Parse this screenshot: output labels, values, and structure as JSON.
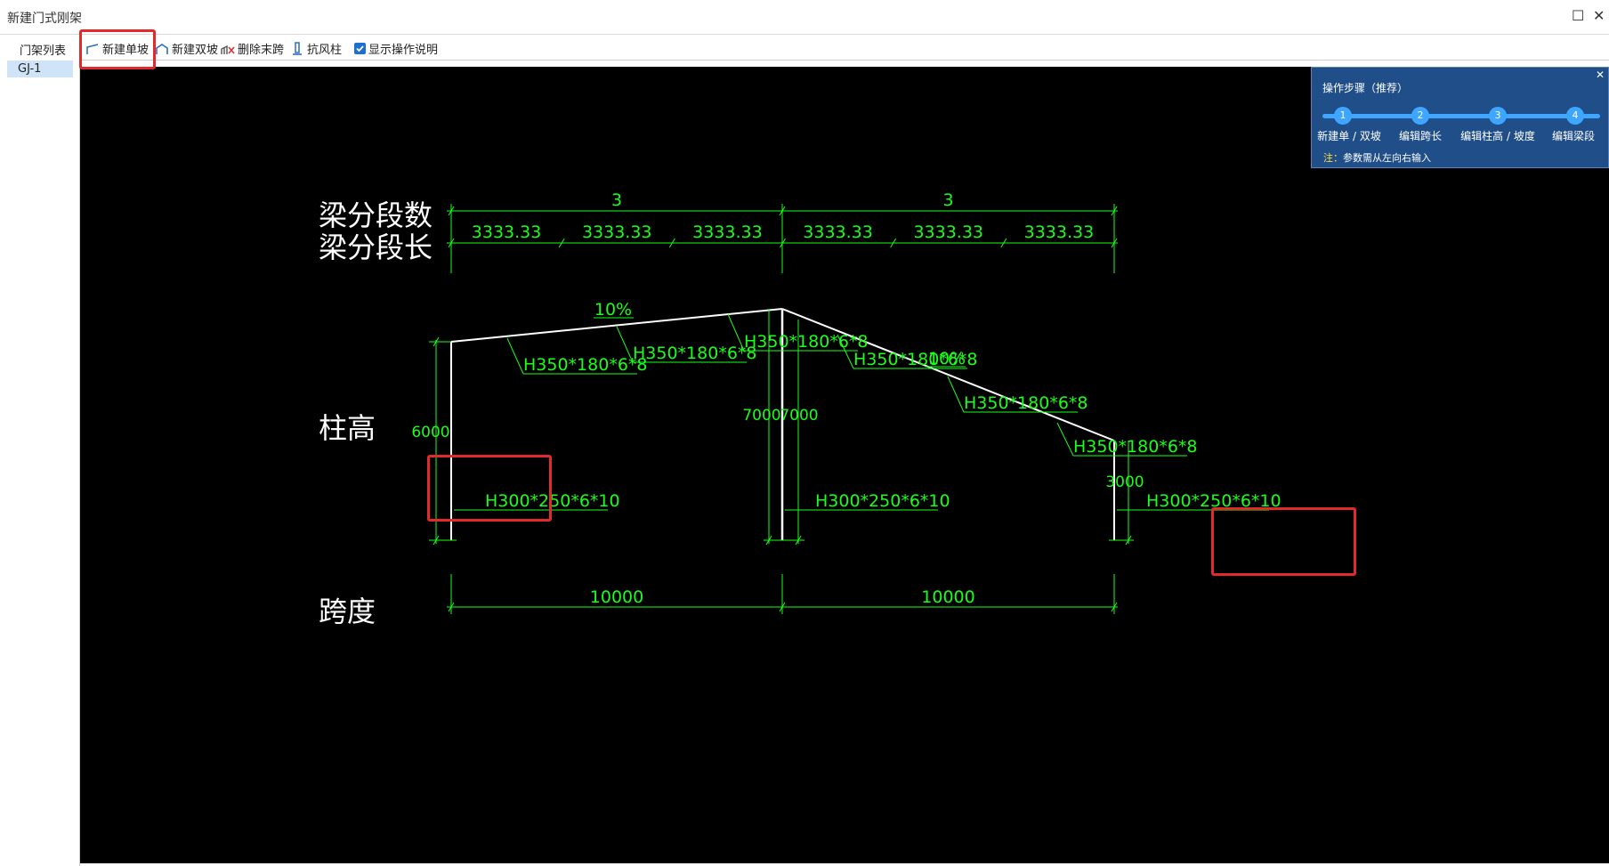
{
  "window": {
    "title": "新建门式刚架"
  },
  "toolbar": {
    "new_single_slope": "新建单坡",
    "new_double_slope": "新建双坡",
    "delete_end_span": "删除末跨",
    "wind_column": "抗风柱",
    "show_instructions": "显示操作说明"
  },
  "left_panel": {
    "title": "门架列表",
    "items": [
      "GJ-1"
    ]
  },
  "overlay": {
    "title": "操作步骤（推荐）",
    "steps": [
      {
        "num": "1",
        "label": "新建单 / 双坡"
      },
      {
        "num": "2",
        "label": "编辑跨长"
      },
      {
        "num": "3",
        "label": "编辑柱高 / 坡度"
      },
      {
        "num": "4",
        "label": "编辑梁段"
      }
    ],
    "note_prefix": "注：",
    "note_text": "参数需从左向右输入"
  },
  "drawing": {
    "row_labels": {
      "beam_segment_count": "梁分段数",
      "beam_segment_length": "梁分段长",
      "column_height": "柱高",
      "span": "跨度"
    },
    "segment_counts": [
      "3",
      "3"
    ],
    "segment_lengths": [
      "3333.33",
      "3333.33",
      "3333.33",
      "3333.33",
      "3333.33",
      "3333.33"
    ],
    "slopes": [
      "10%",
      "10%"
    ],
    "beam_sections": [
      "H350*180*6*8",
      "H350*180*6*8",
      "H350*180*6*8",
      "H350*180*6*8",
      "H350*180*6*8",
      "H350*180*6*8"
    ],
    "column_heights": [
      "6000",
      "7000",
      "7000",
      "3000"
    ],
    "column_sections": [
      "H300*250*6*10",
      "H300*250*6*10",
      "H300*250*6*10"
    ],
    "spans": [
      "10000",
      "10000"
    ],
    "colors": {
      "structure": "#ffffff",
      "dimension": "#19ff19",
      "highlight": "#e32a2a",
      "background": "#000000"
    }
  }
}
